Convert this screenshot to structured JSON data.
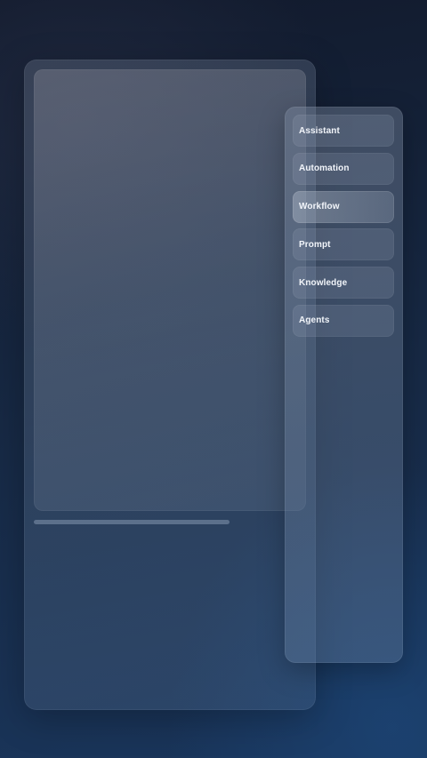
{
  "side_panel": {
    "items": [
      {
        "label": "Assistant",
        "active": false
      },
      {
        "label": "Automation",
        "active": false
      },
      {
        "label": "Workflow",
        "active": true
      },
      {
        "label": "Prompt",
        "active": false
      },
      {
        "label": "Knowledge",
        "active": false
      },
      {
        "label": "Agents",
        "active": false
      }
    ]
  }
}
